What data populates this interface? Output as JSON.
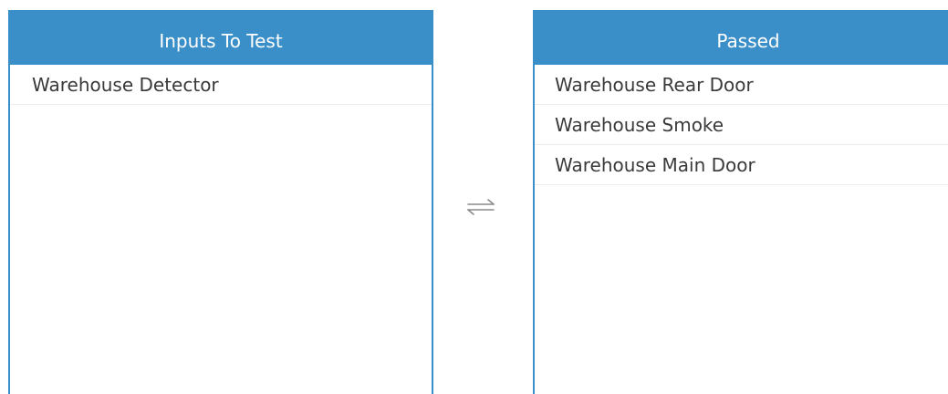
{
  "left_panel": {
    "header": "Inputs To Test",
    "items": [
      {
        "label": "Warehouse Detector"
      }
    ]
  },
  "right_panel": {
    "header": "Passed",
    "items": [
      {
        "label": "Warehouse Rear Door"
      },
      {
        "label": "Warehouse Smoke"
      },
      {
        "label": "Warehouse Main Door"
      }
    ]
  },
  "swap": {
    "icon": "swap-arrows-icon"
  },
  "colors": {
    "header_bg": "#3a8fc8",
    "header_text": "#ffffff",
    "item_text": "#3a3a3a",
    "divider": "#ececec"
  }
}
